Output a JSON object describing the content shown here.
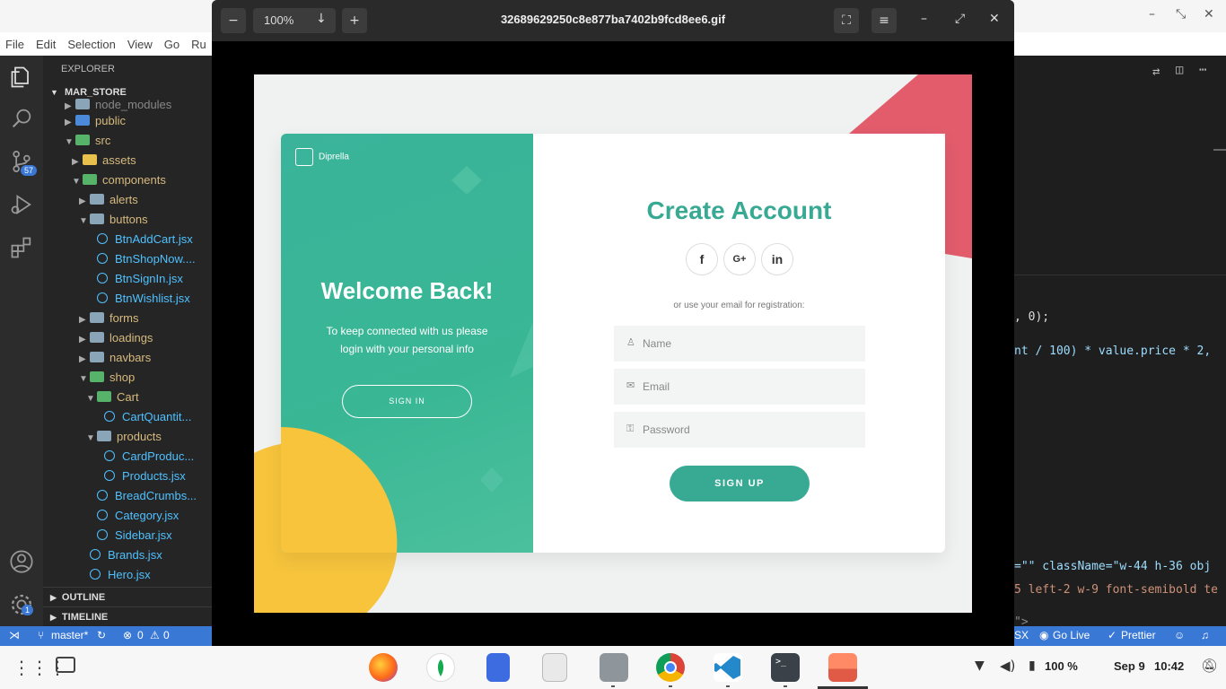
{
  "vscode": {
    "menu": [
      "File",
      "Edit",
      "Selection",
      "View",
      "Go",
      "Ru"
    ],
    "explorer_title": "EXPLORER",
    "project": "MAR_STORE",
    "badges": {
      "scm": "57",
      "settings": "1"
    },
    "tree": [
      {
        "label": "node_modules",
        "indent": 1,
        "kind": "folder",
        "open": false
      },
      {
        "label": "public",
        "indent": 1,
        "kind": "folder",
        "open": false
      },
      {
        "label": "src",
        "indent": 1,
        "kind": "folder",
        "open": true
      },
      {
        "label": "assets",
        "indent": 2,
        "kind": "folder",
        "open": false
      },
      {
        "label": "components",
        "indent": 2,
        "kind": "folder",
        "open": true
      },
      {
        "label": "alerts",
        "indent": 3,
        "kind": "folder",
        "open": false
      },
      {
        "label": "buttons",
        "indent": 3,
        "kind": "folder",
        "open": true
      },
      {
        "label": "BtnAddCart.jsx",
        "indent": 4,
        "kind": "file"
      },
      {
        "label": "BtnShopNow....",
        "indent": 4,
        "kind": "file"
      },
      {
        "label": "BtnSignIn.jsx",
        "indent": 4,
        "kind": "file"
      },
      {
        "label": "BtnWishlist.jsx",
        "indent": 4,
        "kind": "file"
      },
      {
        "label": "forms",
        "indent": 3,
        "kind": "folder",
        "open": false
      },
      {
        "label": "loadings",
        "indent": 3,
        "kind": "folder",
        "open": false
      },
      {
        "label": "navbars",
        "indent": 3,
        "kind": "folder",
        "open": false
      },
      {
        "label": "shop",
        "indent": 3,
        "kind": "folder",
        "open": true
      },
      {
        "label": "Cart",
        "indent": 4,
        "kind": "folder",
        "open": true
      },
      {
        "label": "CartQuantit...",
        "indent": 5,
        "kind": "file"
      },
      {
        "label": "products",
        "indent": 4,
        "kind": "folder",
        "open": true
      },
      {
        "label": "CardProduc...",
        "indent": 5,
        "kind": "file"
      },
      {
        "label": "Products.jsx",
        "indent": 5,
        "kind": "file"
      },
      {
        "label": "BreadCrumbs...",
        "indent": 4,
        "kind": "file"
      },
      {
        "label": "Category.jsx",
        "indent": 4,
        "kind": "file"
      },
      {
        "label": "Sidebar.jsx",
        "indent": 4,
        "kind": "file"
      },
      {
        "label": "Brands.jsx",
        "indent": 3,
        "kind": "file"
      },
      {
        "label": "Hero.jsx",
        "indent": 3,
        "kind": "file"
      }
    ],
    "outline": "OUTLINE",
    "timeline": "TIMELINE",
    "code_lines": [
      ", 0);",
      "nt / 100) * value.price * 2,",
      "=\"\" className=\"w-44 h-36 obj",
      "5 left-2 w-9 font-semibold te",
      "\">"
    ],
    "status": {
      "branch": "master*",
      "problems": "0",
      "warnings": "0",
      "jsx": "SX",
      "golive": "Go Live",
      "prettier": "Prettier"
    }
  },
  "viewer": {
    "zoom": "100%",
    "filename": "32689629250c8e877ba7402b9fcd8ee6.gif",
    "image": {
      "brand": "Diprella",
      "welcome": "Welcome Back!",
      "keep_text": "To keep connected with us please login with your personal info",
      "signin": "SIGN IN",
      "create": "Create Account",
      "socials": [
        "f",
        "G+",
        "in"
      ],
      "or_text": "or use your email for registration:",
      "name_ph": "Name",
      "email_ph": "Email",
      "password_ph": "Password",
      "signup": "SIGN UP",
      "colors": {
        "teal": "#38a993",
        "red": "#e25c6c",
        "yellow": "#f7c43c"
      }
    }
  },
  "taskbar": {
    "battery": "100 %",
    "date": "Sep 9",
    "time": "10:42"
  }
}
